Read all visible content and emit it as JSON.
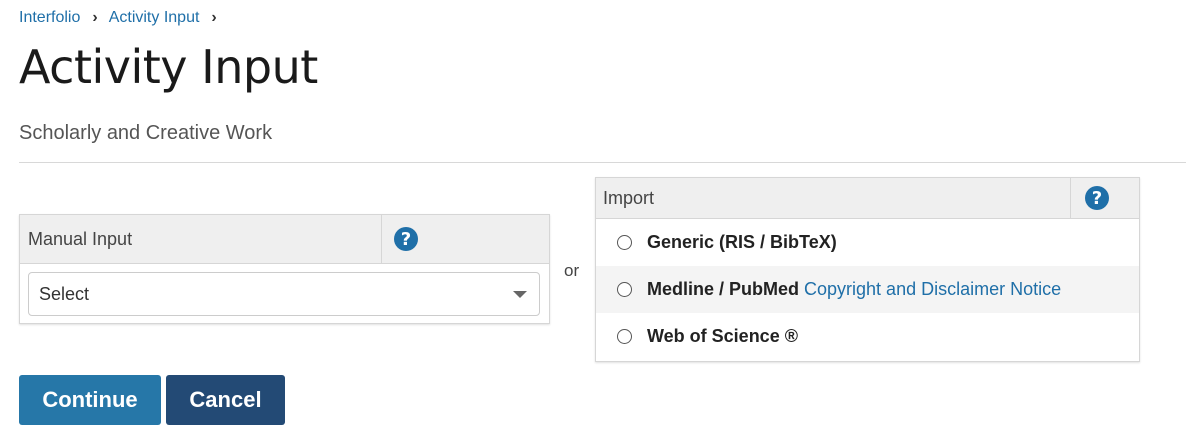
{
  "breadcrumb": {
    "items": [
      {
        "label": "Interfolio"
      },
      {
        "label": "Activity Input"
      }
    ],
    "separator": "›"
  },
  "page": {
    "title": "Activity Input",
    "subtitle": "Scholarly and Creative Work"
  },
  "manual_input": {
    "title": "Manual Input",
    "help_icon": "?",
    "select": {
      "value": "Select"
    }
  },
  "or_label": "or",
  "import": {
    "title": "Import",
    "help_icon": "?",
    "options": [
      {
        "label": "Generic (RIS / BibTeX)",
        "link": ""
      },
      {
        "label": "Medline / PubMed",
        "link": "Copyright and Disclaimer Notice"
      },
      {
        "label": "Web of Science ®",
        "link": ""
      }
    ]
  },
  "buttons": {
    "continue_label": "Continue",
    "cancel_label": "Cancel"
  },
  "colors": {
    "link": "#1f6fa8",
    "continue_bg": "#2677a8",
    "cancel_bg": "#234a75",
    "help_icon_bg": "#1f6fa8"
  }
}
